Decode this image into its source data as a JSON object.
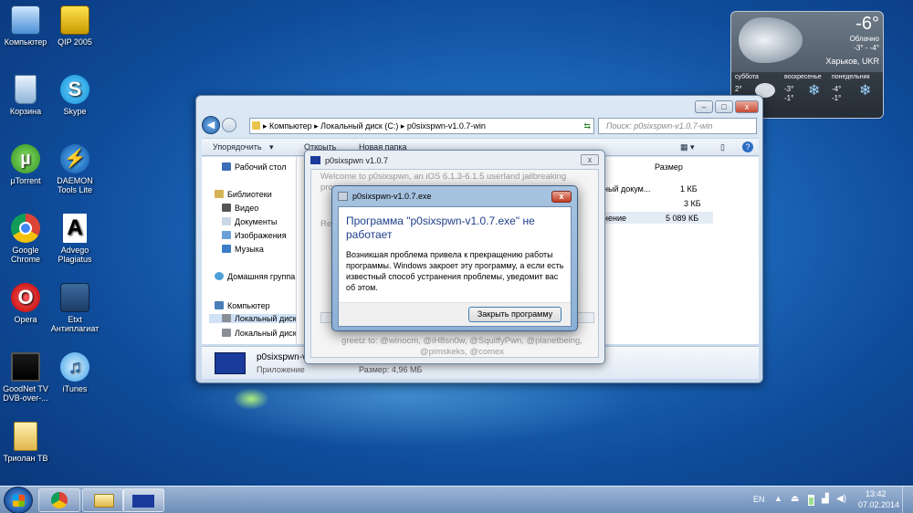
{
  "desktop": {
    "icons": [
      {
        "label": "Компьютер"
      },
      {
        "label": "QIP 2005"
      },
      {
        "label": "Корзина"
      },
      {
        "label": "Skype"
      },
      {
        "label": "µTorrent"
      },
      {
        "label": "DAEMON Tools Lite"
      },
      {
        "label": "Google Chrome"
      },
      {
        "label": "Advego Plagiatus"
      },
      {
        "label": "Opera"
      },
      {
        "label": "Etxt Антиплагиат"
      },
      {
        "label": "GoodNet TV DVB-over-..."
      },
      {
        "label": "iTunes"
      },
      {
        "label": "Триолан ТВ"
      }
    ]
  },
  "weather": {
    "temp": "-6°",
    "condition": "Облачно",
    "range": "-3° - -4°",
    "city": "Харьков, UKR",
    "days": [
      {
        "name": "суббота",
        "hi": "2°",
        "lo": "1°"
      },
      {
        "name": "воскресенье",
        "hi": "-3°",
        "lo": "-1°"
      },
      {
        "name": "понедельник",
        "hi": "-4°",
        "lo": "-1°"
      }
    ]
  },
  "explorer": {
    "breadcrumb": [
      "Компьютер",
      "Локальный диск (C:)",
      "p0sixspwn-v1.0.7-win"
    ],
    "search_placeholder": "Поиск: p0sixspwn-v1.0.7-win",
    "toolbar": {
      "organize": "Упорядочить",
      "open": "Открыть",
      "new_folder": "Новая папка"
    },
    "nav": [
      {
        "label": "Рабочий стол"
      },
      {
        "label": "Библиотеки"
      },
      {
        "label": "Видео"
      },
      {
        "label": "Документы"
      },
      {
        "label": "Изображения"
      },
      {
        "label": "Музыка"
      },
      {
        "label": "Домашняя группа"
      },
      {
        "label": "Компьютер"
      },
      {
        "label": "Локальный диск"
      },
      {
        "label": "Локальный диск"
      }
    ],
    "column_size": "Размер",
    "rows": [
      {
        "type": "ный докум...",
        "size": "1 КБ"
      },
      {
        "type": "",
        "size": "3 КБ"
      },
      {
        "type": "нение",
        "size": "5 089 КБ"
      }
    ],
    "details": {
      "name": "p0sixspwn-v1...",
      "kind": "Приложение",
      "size": "Размер: 4,96 МБ"
    }
  },
  "p0sixspwn": {
    "title": "p0sixspwn v1.0.7",
    "welcome": "Welcome to p0sixspwn, an iOS 6.1.3-6.1.5 userland jailbreaking",
    "line2": "pro",
    "line3": "Reb",
    "greetz": "greetz to: @winocm, @iH8sn0w, @SquiffyPwn, @planetbeing, @pimskeks, @comex"
  },
  "error_dialog": {
    "title": "p0sixspwn-v1.0.7.exe",
    "heading": "Программа \"p0sixspwn-v1.0.7.exe\" не работает",
    "description": "Возникшая проблема привела к прекращению работы программы. Windows закроет эту программу, а если есть известный способ устранения проблемы, уведомит вас об этом.",
    "close_button": "Закрыть программу",
    "close_x": "x"
  },
  "taskbar": {
    "lang": "EN",
    "time": "13:42",
    "date": "07.02.2014"
  }
}
